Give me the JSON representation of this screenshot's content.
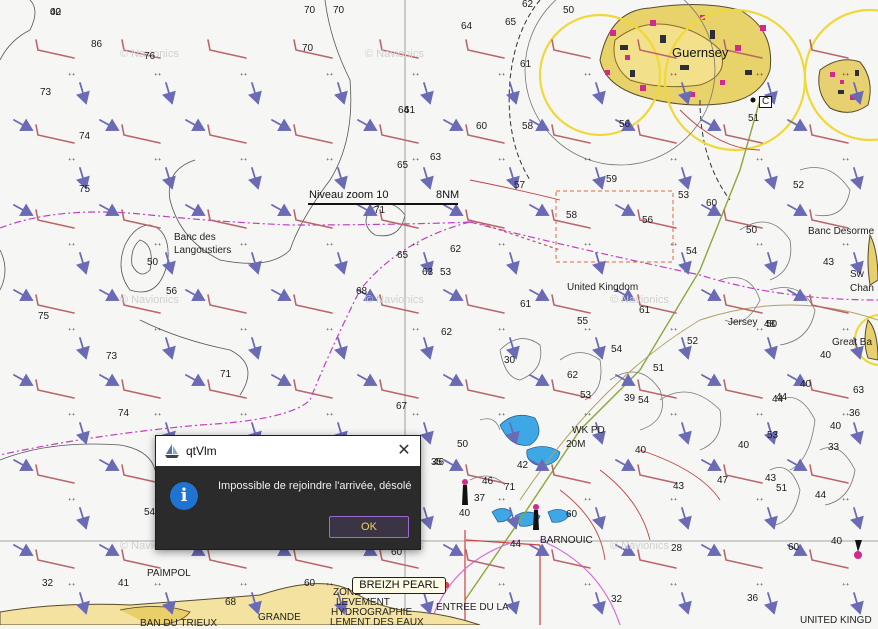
{
  "chart": {
    "zoom_label": "Niveau zoom 10",
    "scale_label": "8NM",
    "watermark": "© Navionics",
    "boat": {
      "name": "BREIZH PEARL"
    },
    "places": [
      {
        "id": "guernsey",
        "text": "Guernsey"
      },
      {
        "id": "united-kingdom",
        "text": "United Kingdom"
      },
      {
        "id": "jersey",
        "text": "Jersey"
      },
      {
        "id": "banc-desormes",
        "text": "Banc Desorme"
      },
      {
        "id": "banc-langoustiers-1",
        "text": "Banc des"
      },
      {
        "id": "banc-langoustiers-2",
        "text": "Langoustiers"
      },
      {
        "id": "great-bank",
        "text": "Great Ba"
      },
      {
        "id": "sw-channel-1",
        "text": "Sw"
      },
      {
        "id": "sw-channel-2",
        "text": "Chan"
      },
      {
        "id": "wk-pd",
        "text": "WK PD"
      },
      {
        "id": "20m",
        "text": "20M"
      },
      {
        "id": "barnouic",
        "text": "BARNOUIC"
      },
      {
        "id": "paimpol",
        "text": "PAIMPOL"
      },
      {
        "id": "zone",
        "text": "ZONE"
      },
      {
        "id": "levement",
        "text": "LEVEMENT"
      },
      {
        "id": "hydrographie",
        "text": "HYDROGRAPHIE"
      },
      {
        "id": "entree-du-la",
        "text": "ENTREE DU LA"
      },
      {
        "id": "lement-des-eaux",
        "text": "LEMENT DES EAUX"
      },
      {
        "id": "ban-du-trieux",
        "text": "BAN DU TRIEUX"
      },
      {
        "id": "grande",
        "text": "GRANDE"
      },
      {
        "id": "united-king",
        "text": "UNITED KINGD"
      },
      {
        "id": "c-marker",
        "text": "C"
      }
    ],
    "depths": [
      "00",
      "86",
      "76",
      "70",
      "70",
      "70",
      "64",
      "65",
      "62",
      "73",
      "74",
      "75",
      "61",
      "64",
      "58",
      "61",
      "60",
      "63",
      "65",
      "57",
      "59",
      "56",
      "53",
      "60",
      "71",
      "58",
      "56",
      "50",
      "51",
      "52",
      "50",
      "62",
      "54",
      "56",
      "63",
      "61",
      "68",
      "65",
      "50",
      "43",
      "62",
      "54",
      "61",
      "55",
      "75",
      "73",
      "52",
      "50",
      "40",
      "51",
      "48",
      "30",
      "71",
      "67",
      "53",
      "54",
      "40",
      "40",
      "46",
      "50",
      "74",
      "44",
      "36",
      "63",
      "33",
      "40",
      "44",
      "43",
      "47",
      "43",
      "44",
      "35",
      "46",
      "51",
      "40",
      "37",
      "42",
      "54",
      "40",
      "71",
      "60",
      "60",
      "39",
      "53",
      "53",
      "62",
      "40",
      "44",
      "60",
      "28",
      "32",
      "36",
      "32",
      "41",
      "68",
      "60",
      "42"
    ]
  },
  "dialog": {
    "title": "qtVlm",
    "close_label": "✕",
    "message": "Impossible de rejoindre l'arrivée, désolé",
    "info_label": "i",
    "ok_label": "OK"
  }
}
